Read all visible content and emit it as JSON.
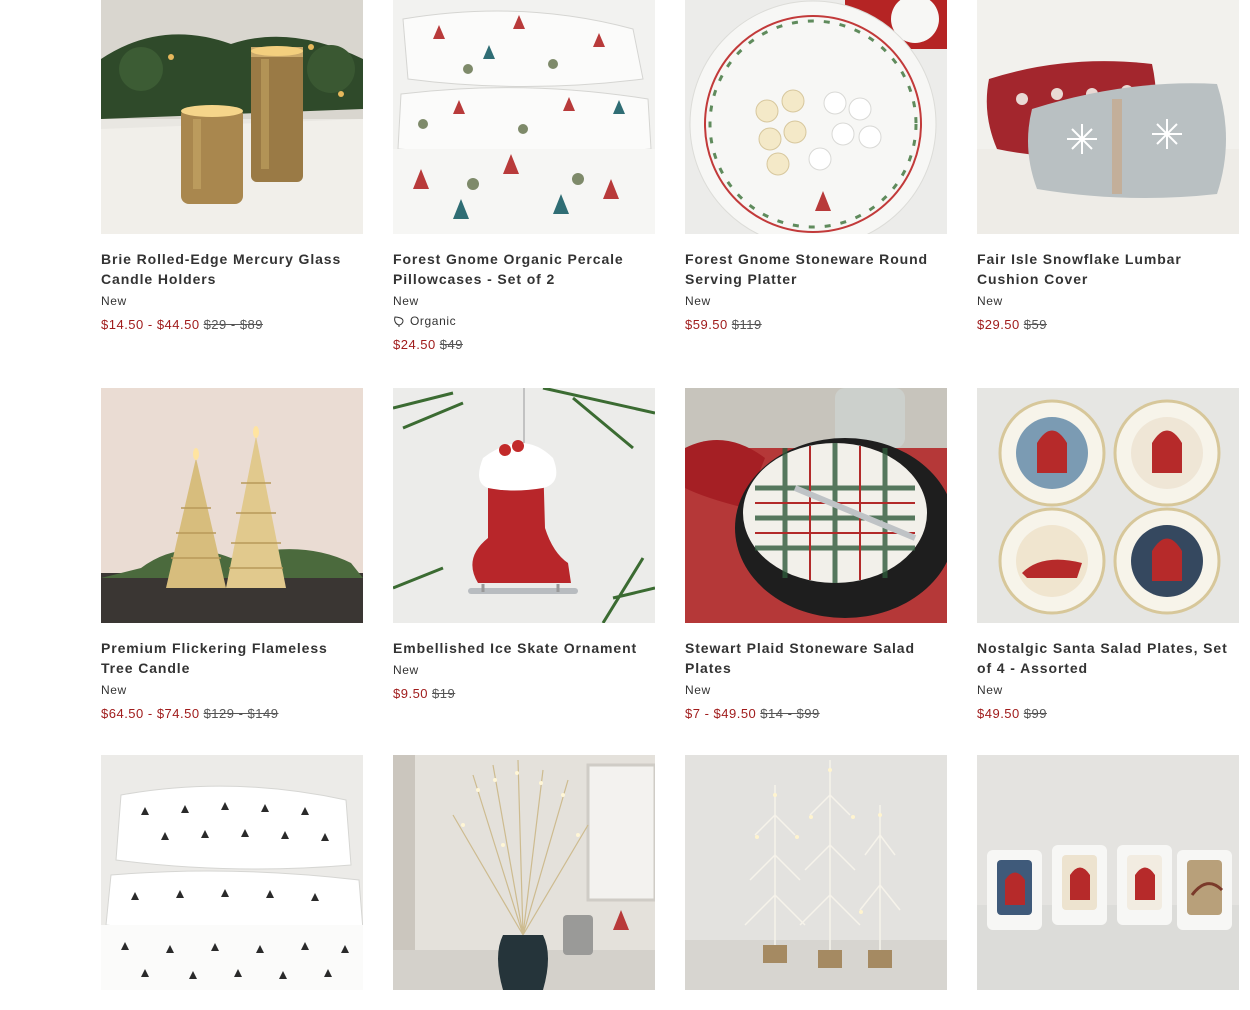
{
  "products": [
    {
      "name": "Brie Rolled-Edge Mercury Glass Candle Holders",
      "badge": "New",
      "sale_price": "$14.50 - $44.50",
      "original_price": "$29 - $89"
    },
    {
      "name": "Forest Gnome Organic Percale Pillowcases - Set of 2",
      "badge": "New",
      "attribute": "Organic",
      "attribute_icon": "organic-leaf-icon",
      "sale_price": "$24.50",
      "original_price": "$49"
    },
    {
      "name": "Forest Gnome Stoneware Round Serving Platter",
      "badge": "New",
      "sale_price": "$59.50",
      "original_price": "$119"
    },
    {
      "name": "Fair Isle Snowflake Lumbar Cushion Cover",
      "badge": "New",
      "sale_price": "$29.50",
      "original_price": "$59"
    },
    {
      "name": "Premium Flickering Flameless Tree Candle",
      "badge": "New",
      "sale_price": "$64.50 - $74.50",
      "original_price": "$129 - $149"
    },
    {
      "name": "Embellished Ice Skate Ornament",
      "badge": "New",
      "sale_price": "$9.50",
      "original_price": "$19"
    },
    {
      "name": "Stewart Plaid Stoneware Salad Plates",
      "badge": "New",
      "sale_price": "$7 - $49.50",
      "original_price": "$14 - $99"
    },
    {
      "name": "Nostalgic Santa Salad Plates, Set of 4 - Assorted",
      "badge": "New",
      "sale_price": "$49.50",
      "original_price": "$99"
    },
    {
      "name": "",
      "badge": "",
      "sale_price": "",
      "original_price": ""
    },
    {
      "name": "",
      "badge": "",
      "sale_price": "",
      "original_price": ""
    },
    {
      "name": "",
      "badge": "",
      "sale_price": "",
      "original_price": ""
    },
    {
      "name": "",
      "badge": "",
      "sale_price": "",
      "original_price": ""
    }
  ],
  "colors": {
    "sale": "#a01c1c",
    "text": "#333333"
  }
}
